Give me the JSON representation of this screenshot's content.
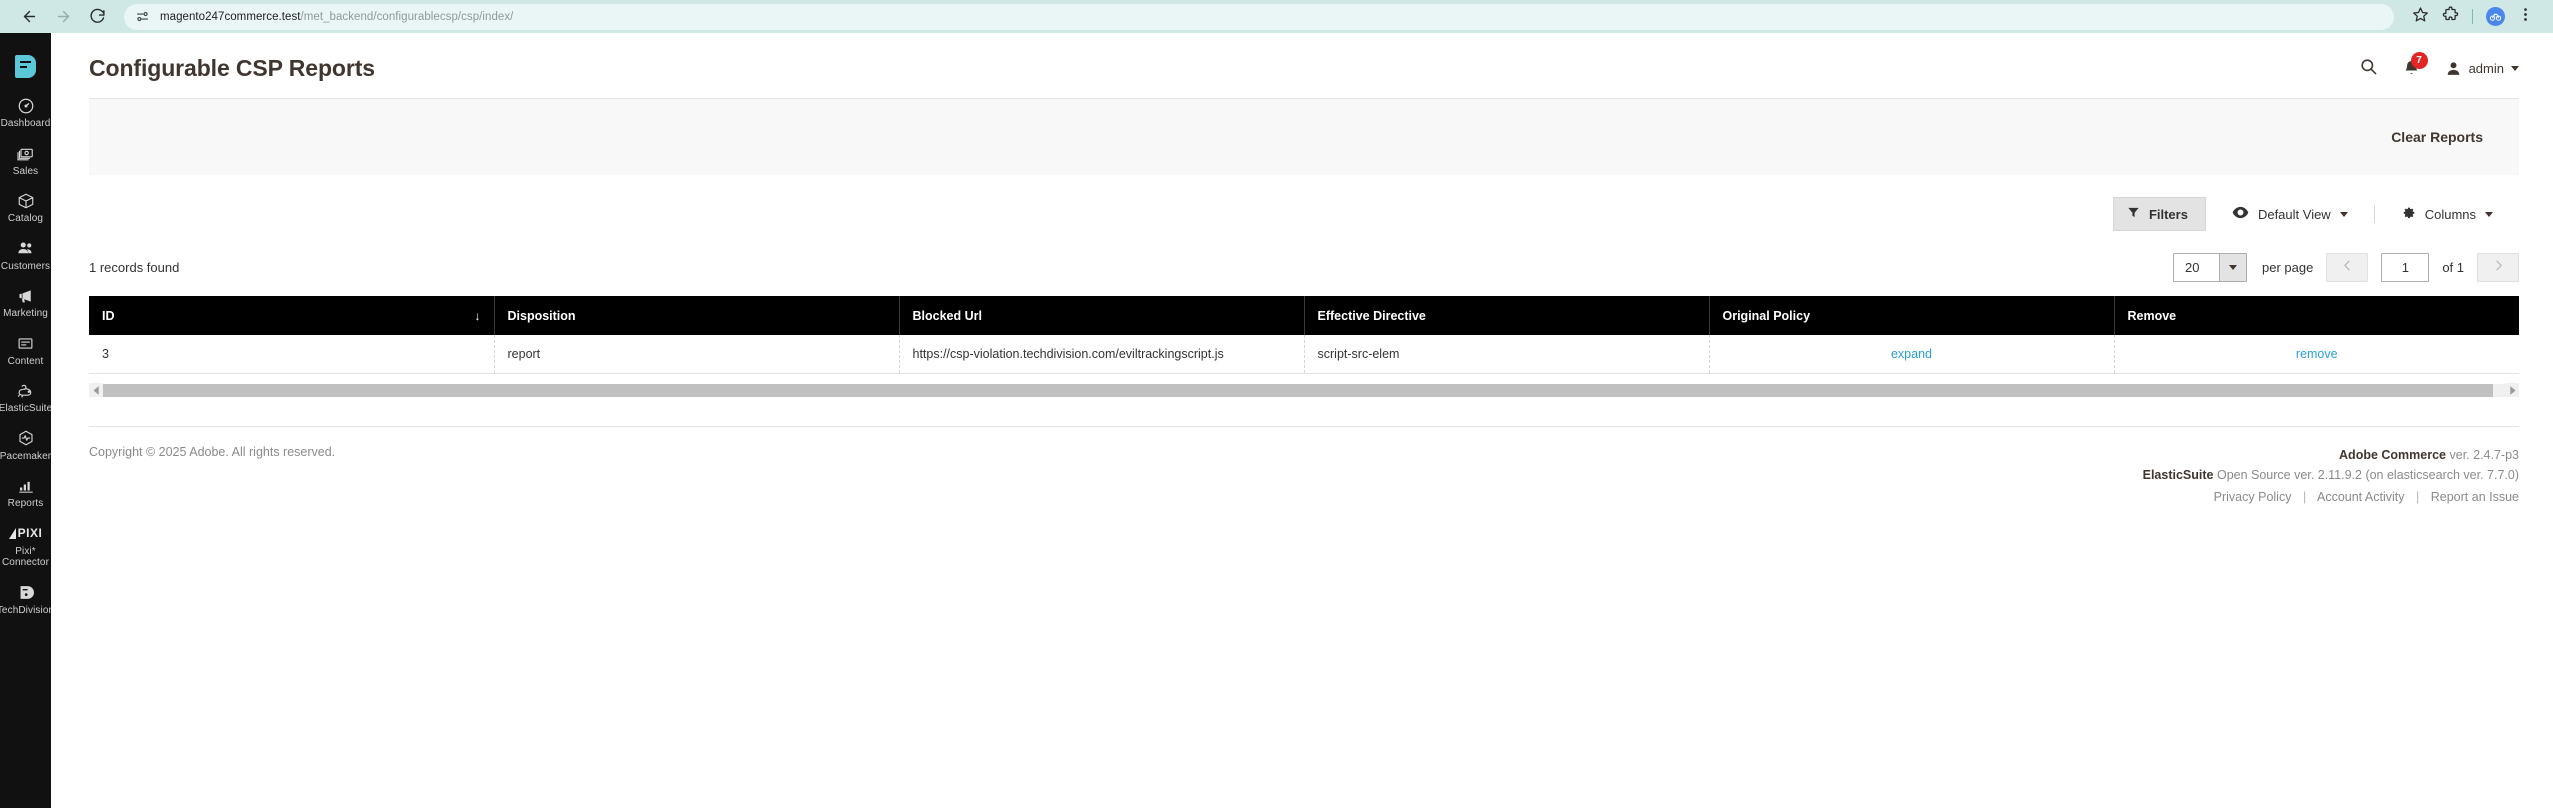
{
  "browser": {
    "back_icon": "back-arrow-icon",
    "forward_icon": "forward-arrow-icon",
    "reload_icon": "reload-icon",
    "site_info_icon": "site-settings-icon",
    "url_host": "magento247commerce.test",
    "url_path": "/met_backend/configurablecsp/csp/index/",
    "bookmark_icon": "star-icon",
    "extensions_icon": "puzzle-piece-icon",
    "profile_icon": "profile-avatar-icon",
    "menu_icon": "kebab-menu-icon"
  },
  "sidebar": {
    "logo": "magento-admin-logo",
    "items": [
      {
        "label": "Dashboard",
        "icon": "dashboard-gauge-icon"
      },
      {
        "label": "Sales",
        "icon": "money-stack-icon"
      },
      {
        "label": "Catalog",
        "icon": "box-icon"
      },
      {
        "label": "Customers",
        "icon": "people-icon"
      },
      {
        "label": "Marketing",
        "icon": "megaphone-icon"
      },
      {
        "label": "Content",
        "icon": "content-layout-icon"
      },
      {
        "label": "ElasticSuite",
        "icon": "elasticsuite-rabbit-icon"
      },
      {
        "label": "Pacemaker",
        "icon": "pacemaker-pulse-icon"
      },
      {
        "label": "Pixi* Connector",
        "icon": "pixi-wordmark-icon"
      },
      {
        "label": "Reports",
        "icon": "bar-chart-icon"
      },
      {
        "label": "TechDivision",
        "icon": "techdivision-logo-icon"
      }
    ]
  },
  "header": {
    "title": "Configurable CSP Reports",
    "search_icon": "search-icon",
    "notifications_icon": "bell-icon",
    "notifications_count": "7",
    "user_icon": "user-avatar-icon",
    "user_name": "admin"
  },
  "actions": {
    "clear_reports_label": "Clear Reports"
  },
  "toolbar": {
    "filters_label": "Filters",
    "filters_icon": "funnel-icon",
    "view_icon": "eye-icon",
    "view_label": "Default View",
    "columns_icon": "gear-icon",
    "columns_label": "Columns"
  },
  "listing": {
    "records_found": "1 records found",
    "per_page_value": "20",
    "per_page_label": "per page",
    "prev_icon": "chevron-left-icon",
    "next_icon": "chevron-right-icon",
    "current_page": "1",
    "total_pages_label": "of 1",
    "scrollbar_left_icon": "scroll-left-arrow-icon",
    "scrollbar_right_icon": "scroll-right-arrow-icon"
  },
  "table": {
    "columns": [
      {
        "label": "ID",
        "sorted": true,
        "sort_icon": "↓"
      },
      {
        "label": "Disposition",
        "sorted": false
      },
      {
        "label": "Blocked Url",
        "sorted": false
      },
      {
        "label": "Effective Directive",
        "sorted": false
      },
      {
        "label": "Original Policy",
        "sorted": false
      },
      {
        "label": "Remove",
        "sorted": false
      }
    ],
    "rows": [
      {
        "id": "3",
        "disposition": "report",
        "blocked_url": "https://csp-violation.techdivision.com/eviltrackingscript.js",
        "effective_directive": "script-src-elem",
        "original_policy_link": "expand",
        "remove_link": "remove"
      }
    ]
  },
  "footer": {
    "copyright": "Copyright © 2025 Adobe. All rights reserved.",
    "product_name": "Adobe Commerce",
    "product_version": "ver. 2.4.7-p3",
    "module_name": "ElasticSuite",
    "module_version": "Open Source ver. 2.11.9.2 (on elasticsearch ver. 7.7.0)",
    "links": [
      {
        "label": "Privacy Policy"
      },
      {
        "label": "Account Activity"
      },
      {
        "label": "Report an Issue"
      }
    ],
    "link_separator": "|"
  },
  "colors": {
    "browser_bar": "#cfe8e6",
    "sidebar": "#111111",
    "table_header": "#000000",
    "link": "#2a9fd6",
    "badge": "#e22626",
    "logo_teal": "#5bc8d8"
  }
}
